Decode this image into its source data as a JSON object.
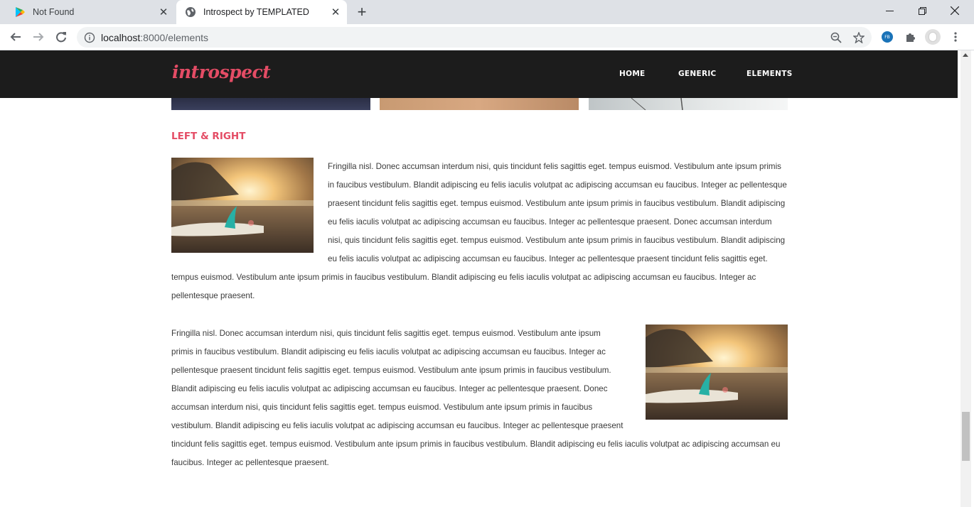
{
  "browser": {
    "tabs": [
      {
        "title": "Not Found",
        "active": false
      },
      {
        "title": "Introspect by TEMPLATED",
        "active": true
      }
    ],
    "url_host": "localhost",
    "url_path": ":8000/elements",
    "profile_badge": "FB"
  },
  "site": {
    "logo": "introspect",
    "nav": [
      "HOME",
      "GENERIC",
      "ELEMENTS"
    ]
  },
  "section": {
    "title": "LEFT & RIGHT",
    "paragraph": "Fringilla nisl. Donec accumsan interdum nisi, quis tincidunt felis sagittis eget. tempus euismod. Vestibulum ante ipsum primis in faucibus vestibulum. Blandit adipiscing eu felis iaculis volutpat ac adipiscing accumsan eu faucibus. Integer ac pellentesque praesent tincidunt felis sagittis eget. tempus euismod. Vestibulum ante ipsum primis in faucibus vestibulum. Blandit adipiscing eu felis iaculis volutpat ac adipiscing accumsan eu faucibus. Integer ac pellentesque praesent. Donec accumsan interdum nisi, quis tincidunt felis sagittis eget. tempus euismod. Vestibulum ante ipsum primis in faucibus vestibulum. Blandit adipiscing eu felis iaculis volutpat ac adipiscing accumsan eu faucibus. Integer ac pellentesque praesent tincidunt felis sagittis eget. tempus euismod. Vestibulum ante ipsum primis in faucibus vestibulum. Blandit adipiscing eu felis iaculis volutpat ac adipiscing accumsan eu faucibus. Integer ac pellentesque praesent."
  },
  "colors": {
    "accent": "#e44c65",
    "header_bg": "#1c1c1c",
    "text": "#3a3a3a"
  }
}
